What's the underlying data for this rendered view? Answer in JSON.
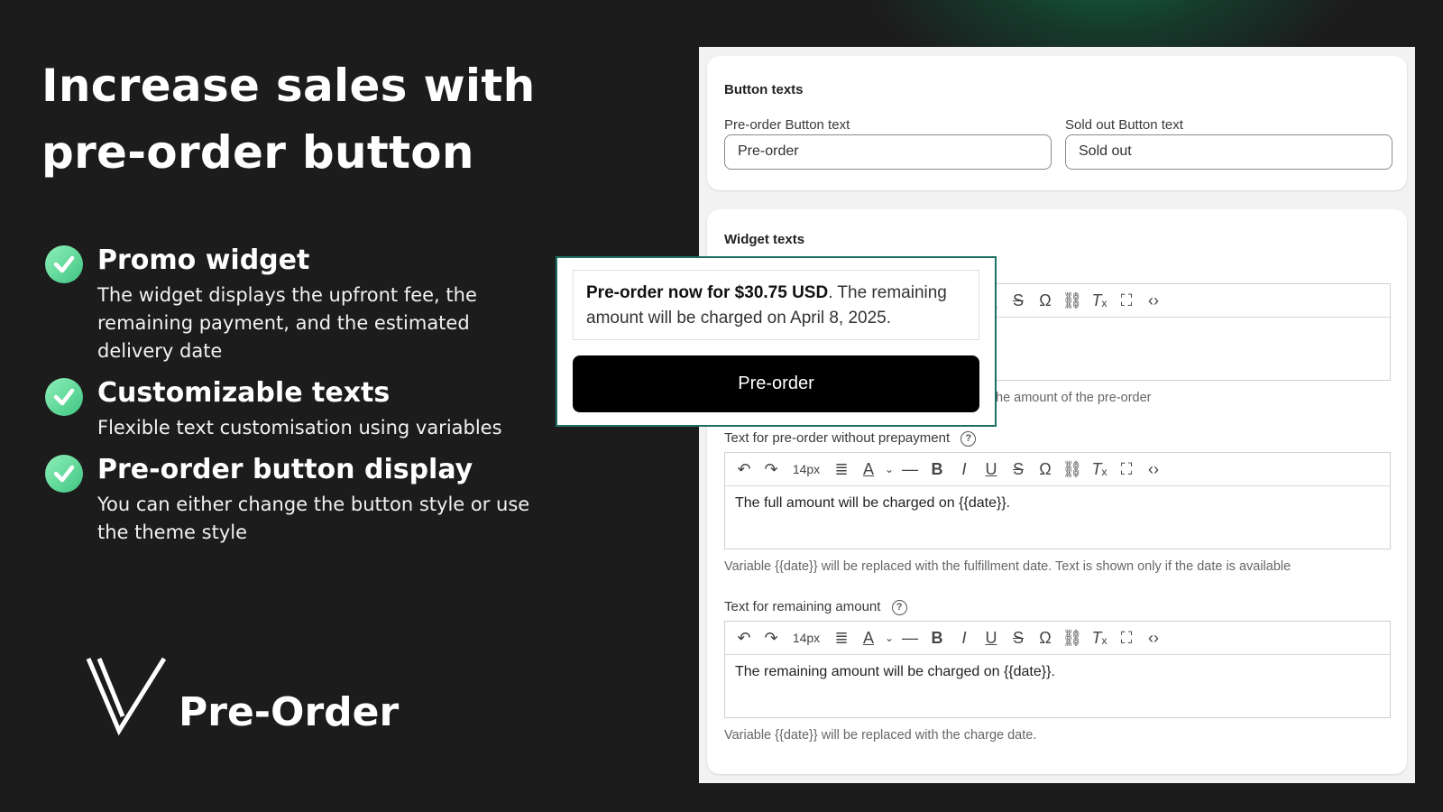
{
  "hero": {
    "headline_line1": "Increase sales with",
    "headline_line2": "pre-order button"
  },
  "features": [
    {
      "title": "Promo widget",
      "desc": "The widget displays the upfront fee, the remaining payment, and the estimated delivery date"
    },
    {
      "title": "Customizable texts",
      "desc": "Flexible text customisation using variables"
    },
    {
      "title": "Pre-order button display",
      "desc": "You can either change the button style or use the theme style"
    }
  ],
  "brand": {
    "name": "Pre-Order",
    "accent": "#3fc583",
    "glow": "#0b8c5a"
  },
  "settings": {
    "button_texts": {
      "title": "Button texts",
      "preorder_label": "Pre-order Button text",
      "preorder_value": "Pre-order",
      "soldout_label": "Sold out Button text",
      "soldout_value": "Sold out"
    },
    "widget_texts": {
      "title": "Widget texts",
      "partial_note": "he amount of the pre-order",
      "without_prepayment": {
        "label": "Text for pre-order without prepayment",
        "font_size": "14px",
        "value": "The full amount will be charged on {{date}}.",
        "note": "Variable {{date}} will be replaced with the fulfillment date. Text is shown only if the date is available"
      },
      "remaining_amount": {
        "label": "Text for remaining amount",
        "font_size": "14px",
        "value": "The remaining amount will be charged on {{date}}.",
        "note": "Variable {{date}} will be replaced with the charge date."
      }
    },
    "toolbar_icons": [
      "undo-icon",
      "redo-icon",
      "font-size-select",
      "align-icon",
      "text-color-icon",
      "horizontal-rule-icon",
      "bold-icon",
      "italic-icon",
      "underline-icon",
      "strikethrough-icon",
      "special-char-icon",
      "link-icon",
      "clear-format-icon",
      "fullscreen-icon",
      "code-icon"
    ]
  },
  "preview": {
    "message_bold": "Pre-order now for $30.75 USD",
    "message_rest": ". The remaining amount will be charged on April 8, 2025.",
    "button_label": "Pre-order"
  }
}
